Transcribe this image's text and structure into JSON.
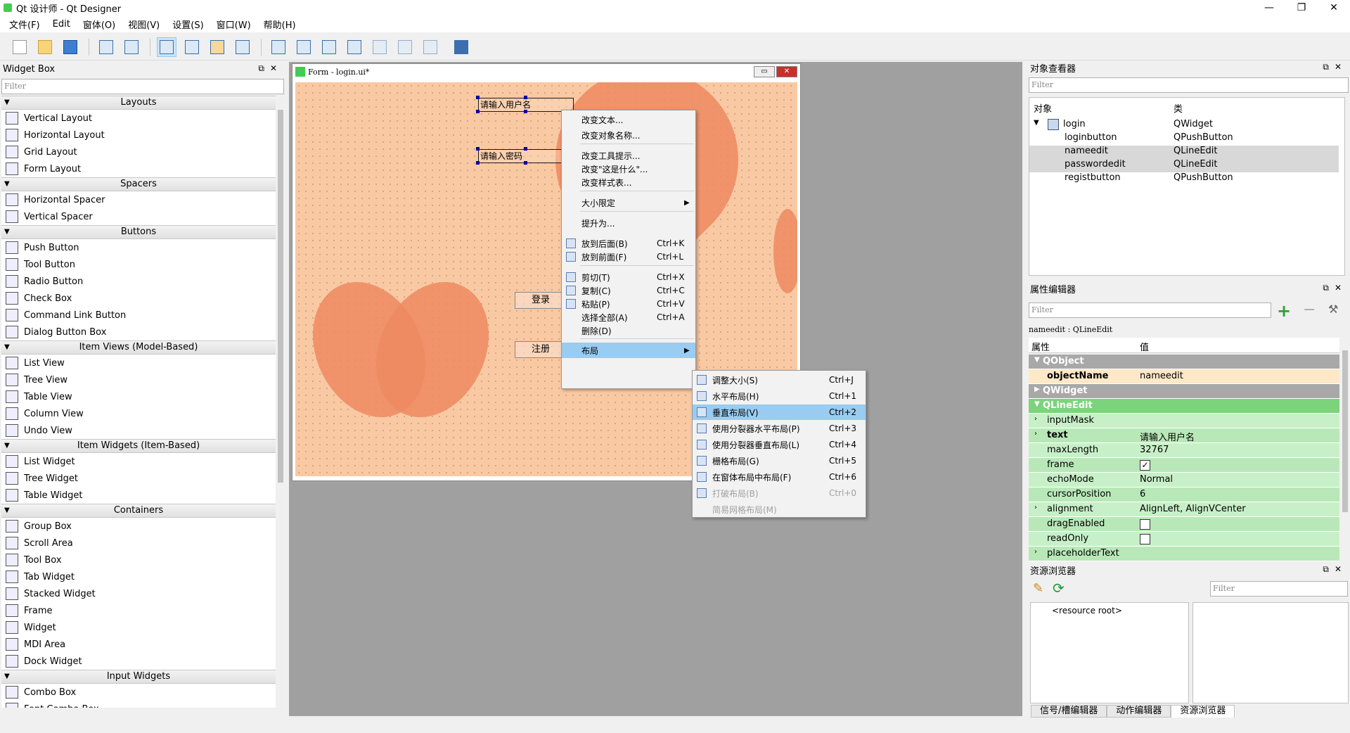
{
  "window": {
    "title": "Qt 设计师 - Qt Designer",
    "min": "—",
    "max": "❐",
    "close": "✕"
  },
  "menubar": [
    "文件(F)",
    "Edit",
    "窗体(O)",
    "视图(V)",
    "设置(S)",
    "窗口(W)",
    "帮助(H)"
  ],
  "toolbar": {
    "icons": [
      "new-file-icon",
      "open-file-icon",
      "save-icon",
      "send-to-back-icon",
      "bring-to-front-icon",
      "edit-widgets-icon",
      "edit-signals-icon",
      "edit-buddies-icon",
      "edit-tab-order-icon",
      "layout-horizontal-icon",
      "layout-vertical-icon",
      "layout-splitter-h-icon",
      "layout-splitter-v-icon",
      "layout-grid-icon",
      "layout-form-icon",
      "break-layout-icon",
      "adjust-size-icon"
    ]
  },
  "widget_box": {
    "title": "Widget Box",
    "filter_placeholder": "Filter",
    "categories": [
      {
        "name": "Layouts",
        "items": [
          "Vertical Layout",
          "Horizontal Layout",
          "Grid Layout",
          "Form Layout"
        ]
      },
      {
        "name": "Spacers",
        "items": [
          "Horizontal Spacer",
          "Vertical Spacer"
        ]
      },
      {
        "name": "Buttons",
        "items": [
          "Push Button",
          "Tool Button",
          "Radio Button",
          "Check Box",
          "Command Link Button",
          "Dialog Button Box"
        ]
      },
      {
        "name": "Item Views (Model-Based)",
        "items": [
          "List View",
          "Tree View",
          "Table View",
          "Column View",
          "Undo View"
        ]
      },
      {
        "name": "Item Widgets (Item-Based)",
        "items": [
          "List Widget",
          "Tree Widget",
          "Table Widget"
        ]
      },
      {
        "name": "Containers",
        "items": [
          "Group Box",
          "Scroll Area",
          "Tool Box",
          "Tab Widget",
          "Stacked Widget",
          "Frame",
          "Widget",
          "MDI Area",
          "Dock Widget"
        ]
      },
      {
        "name": "Input Widgets",
        "items": [
          "Combo Box",
          "Font Combo Box"
        ]
      }
    ]
  },
  "form": {
    "title": "Form - login.ui*",
    "name_edit": "请输入用户名",
    "pass_edit": "请输入密码",
    "login_button": "登录",
    "register_button": "注册"
  },
  "context_menu": {
    "items": [
      {
        "label": "改变文本...",
        "shortcut": ""
      },
      {
        "label": "改变对象名称...",
        "shortcut": ""
      },
      {
        "label": "改变工具提示...",
        "shortcut": ""
      },
      {
        "label": "改变\"这是什么\"...",
        "shortcut": ""
      },
      {
        "label": "改变样式表...",
        "shortcut": ""
      },
      {
        "label": "大小限定",
        "shortcut": ""
      },
      {
        "label": "提升为...",
        "shortcut": ""
      },
      {
        "label": "放到后面(B)",
        "shortcut": "Ctrl+K"
      },
      {
        "label": "放到前面(F)",
        "shortcut": "Ctrl+L"
      },
      {
        "label": "剪切(T)",
        "shortcut": "Ctrl+X"
      },
      {
        "label": "复制(C)",
        "shortcut": "Ctrl+C"
      },
      {
        "label": "粘贴(P)",
        "shortcut": "Ctrl+V"
      },
      {
        "label": "选择全部(A)",
        "shortcut": "Ctrl+A"
      },
      {
        "label": "删除(D)",
        "shortcut": ""
      },
      {
        "label": "布局",
        "shortcut": ""
      }
    ]
  },
  "layout_submenu": {
    "items": [
      {
        "label": "调整大小(S)",
        "shortcut": "Ctrl+J"
      },
      {
        "label": "水平布局(H)",
        "shortcut": "Ctrl+1"
      },
      {
        "label": "垂直布局(V)",
        "shortcut": "Ctrl+2"
      },
      {
        "label": "使用分裂器水平布局(P)",
        "shortcut": "Ctrl+3"
      },
      {
        "label": "使用分裂器垂直布局(L)",
        "shortcut": "Ctrl+4"
      },
      {
        "label": "栅格布局(G)",
        "shortcut": "Ctrl+5"
      },
      {
        "label": "在窗体布局中布局(F)",
        "shortcut": "Ctrl+6"
      },
      {
        "label": "打破布局(B)",
        "shortcut": "Ctrl+0"
      },
      {
        "label": "简易网格布局(M)",
        "shortcut": ""
      }
    ]
  },
  "object_inspector": {
    "title": "对象查看器",
    "filter_placeholder": "Filter",
    "col_object": "对象",
    "col_class": "类",
    "rows": [
      {
        "name": "login",
        "cls": "QWidget"
      },
      {
        "name": "loginbutton",
        "cls": "QPushButton"
      },
      {
        "name": "nameedit",
        "cls": "QLineEdit"
      },
      {
        "name": "passwordedit",
        "cls": "QLineEdit"
      },
      {
        "name": "registbutton",
        "cls": "QPushButton"
      }
    ]
  },
  "property_editor": {
    "title": "属性编辑器",
    "filter_placeholder": "Filter",
    "current": "nameedit : QLineEdit",
    "col_prop": "属性",
    "col_value": "值",
    "groups": {
      "qobject": "QObject",
      "qwidget": "QWidget",
      "qlineedit": "QLineEdit"
    },
    "objectName": {
      "name": "objectName",
      "value": "nameedit"
    },
    "props": [
      {
        "name": "inputMask",
        "value": ""
      },
      {
        "name": "text",
        "value": "请输入用户名"
      },
      {
        "name": "maxLength",
        "value": "32767"
      },
      {
        "name": "frame",
        "value": "✓"
      },
      {
        "name": "echoMode",
        "value": "Normal"
      },
      {
        "name": "cursorPosition",
        "value": "6"
      },
      {
        "name": "alignment",
        "value": "AlignLeft, AlignVCenter"
      },
      {
        "name": "dragEnabled",
        "value": ""
      },
      {
        "name": "readOnly",
        "value": ""
      },
      {
        "name": "placeholderText",
        "value": ""
      }
    ]
  },
  "resource_browser": {
    "title": "资源浏览器",
    "filter_placeholder": "Filter",
    "root": "<resource root>"
  },
  "bottom_tabs": [
    "信号/槽编辑器",
    "动作编辑器",
    "资源浏览器"
  ],
  "colors": {
    "highlight": "#99ccf0",
    "prop_group": "#a8a8a8",
    "prop_lineedit_group": "#7bd47b",
    "prop_row": "#c8f0c8",
    "canvas": "#f9c9a3"
  }
}
